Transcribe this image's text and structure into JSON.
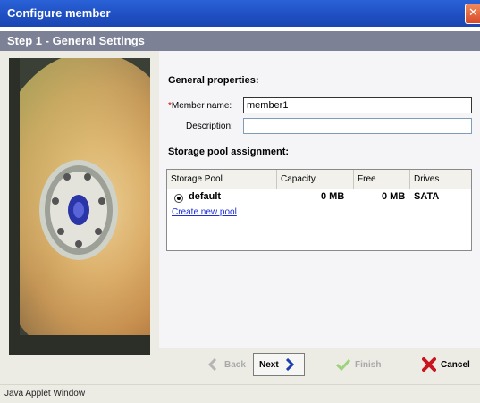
{
  "window": {
    "title": "Configure member"
  },
  "step": {
    "title": "Step 1 - General Settings"
  },
  "general": {
    "heading": "General properties:",
    "member_name_required": "*",
    "member_name_label": "Member name:",
    "member_name_value": "member1",
    "description_label": "Description:",
    "description_value": ""
  },
  "pool": {
    "heading": "Storage pool assignment:",
    "columns": [
      "Storage Pool",
      "Capacity",
      "Free",
      "Drives"
    ],
    "rows": [
      {
        "name": "default",
        "capacity": "0 MB",
        "free": "0 MB",
        "drives": "SATA",
        "selected": true
      }
    ],
    "create_link": "Create new pool"
  },
  "buttons": {
    "back": "Back",
    "next": "Next",
    "finish": "Finish",
    "cancel": "Cancel"
  },
  "icons": {
    "back": "chevron-left-icon",
    "next": "chevron-right-icon",
    "finish": "checkmark-icon",
    "cancel": "x-icon",
    "close": "close-icon"
  },
  "status": {
    "text": "Java Applet Window"
  },
  "colors": {
    "titlebar": "#2356cc",
    "stepbar": "#7d8196",
    "link": "#1e2fd0",
    "next_arrow": "#1b3fb0",
    "cancel_x": "#c8141e",
    "finish_check": "#9fd27c"
  }
}
